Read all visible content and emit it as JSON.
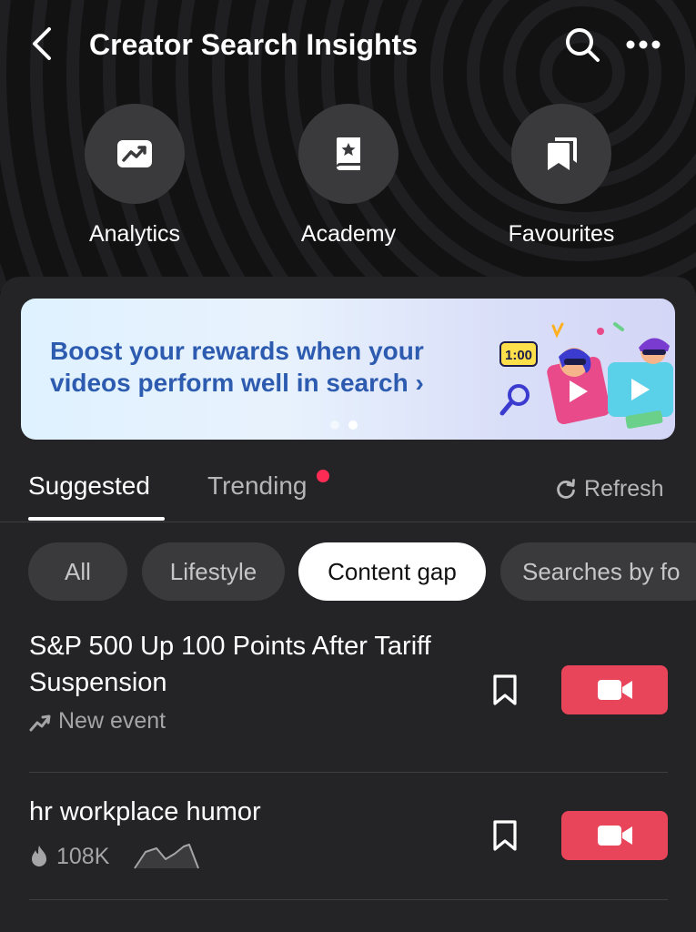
{
  "header": {
    "title": "Creator Search Insights",
    "icons": {
      "back": "chevron-left-icon",
      "search": "search-icon",
      "more": "more-horizontal-icon"
    }
  },
  "shortcuts": [
    {
      "label": "Analytics",
      "icon": "trending-chart-icon"
    },
    {
      "label": "Academy",
      "icon": "book-star-icon"
    },
    {
      "label": "Favourites",
      "icon": "bookmarks-icon"
    }
  ],
  "banner": {
    "text": "Boost your rewards when your videos perform well in search",
    "chevron": "›",
    "art_label": "1:00",
    "page_count": 2,
    "active_page": 2
  },
  "tabs": [
    {
      "label": "Suggested",
      "active": true
    },
    {
      "label": "Trending",
      "active": false,
      "has_notification": true
    }
  ],
  "refresh_label": "Refresh",
  "chips": [
    {
      "label": "All",
      "selected": false
    },
    {
      "label": "Lifestyle",
      "selected": false
    },
    {
      "label": "Content gap",
      "selected": true
    },
    {
      "label": "Searches by fo",
      "selected": false
    }
  ],
  "topics": [
    {
      "title": "S&P 500 Up 100 Points After Tariff Suspension",
      "meta_icon": "trend-arrow-icon",
      "meta_text": "New event"
    },
    {
      "title": "hr workplace humor",
      "meta_icon": "flame-icon",
      "meta_text": "108K",
      "has_sparkline": true
    }
  ],
  "colors": {
    "accent_red": "#fe2c55",
    "record_button": "#e8445a",
    "banner_text": "#2d5bb0",
    "sheet_bg": "#242426",
    "chip_bg": "#3a3a3c"
  }
}
